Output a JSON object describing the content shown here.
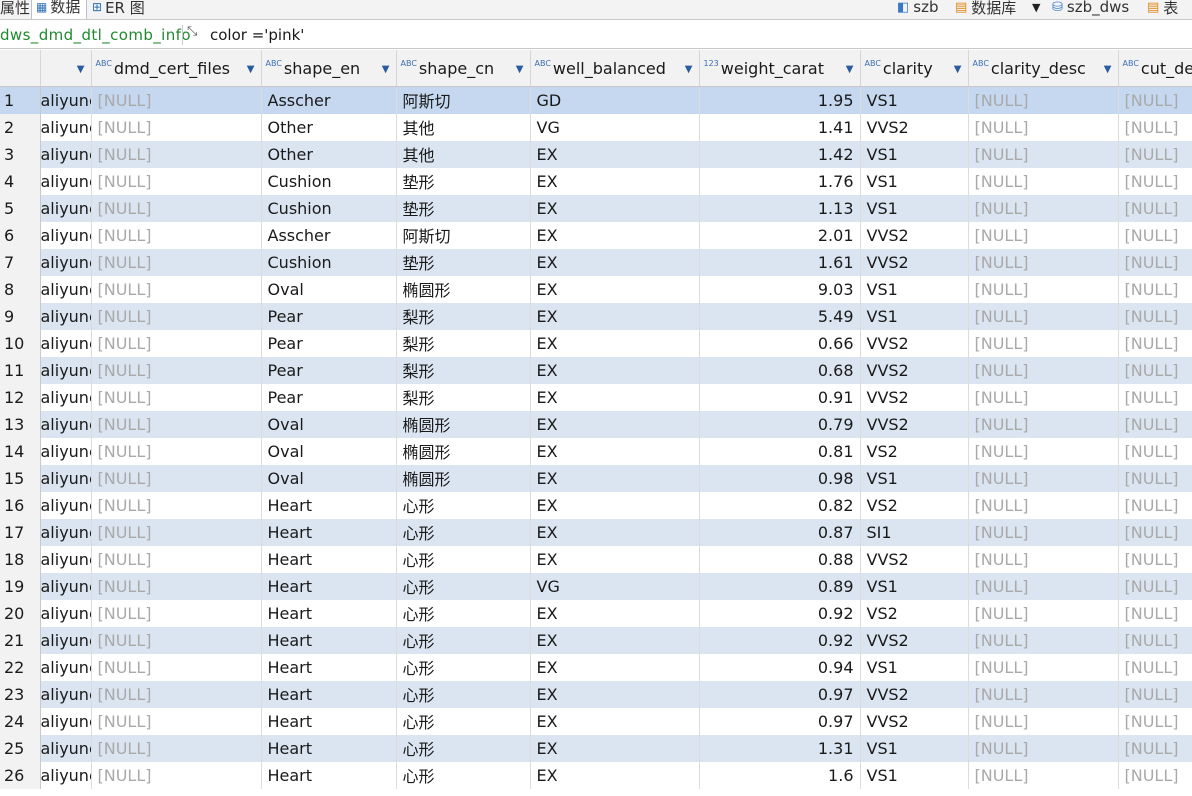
{
  "toolbar": {
    "tab_properties": "属性",
    "tab_data": "数据",
    "tab_er": "ER 图",
    "crumbs": {
      "connection": "szb",
      "database_label": "数据库",
      "schema": "szb_dws",
      "table_label": "表"
    }
  },
  "filter": {
    "table_name": "dws_dmd_dtl_comb_info",
    "expression": "color ='pink'"
  },
  "grid": {
    "columns": [
      {
        "label": "",
        "type": ""
      },
      {
        "label": "dmd_cert_files",
        "type": "ABC"
      },
      {
        "label": "shape_en",
        "type": "ABC"
      },
      {
        "label": "shape_cn",
        "type": "ABC"
      },
      {
        "label": "well_balanced",
        "type": "ABC"
      },
      {
        "label": "weight_carat",
        "type": "123"
      },
      {
        "label": "clarity",
        "type": "ABC"
      },
      {
        "label": "clarity_desc",
        "type": "ABC"
      },
      {
        "label": "cut_de",
        "type": "ABC"
      }
    ],
    "rows": [
      [
        "1",
        "aliyunc",
        "[NULL]",
        "Asscher",
        "阿斯切",
        "GD",
        "1.95",
        "VS1",
        "[NULL]",
        "[NULL]"
      ],
      [
        "2",
        "aliyunc",
        "[NULL]",
        "Other",
        "其他",
        "VG",
        "1.41",
        "VVS2",
        "[NULL]",
        "[NULL]"
      ],
      [
        "3",
        "aliyunc",
        "[NULL]",
        "Other",
        "其他",
        "EX",
        "1.42",
        "VS1",
        "[NULL]",
        "[NULL]"
      ],
      [
        "4",
        "aliyunc",
        "[NULL]",
        "Cushion",
        "垫形",
        "EX",
        "1.76",
        "VS1",
        "[NULL]",
        "[NULL]"
      ],
      [
        "5",
        "aliyunc",
        "[NULL]",
        "Cushion",
        "垫形",
        "EX",
        "1.13",
        "VS1",
        "[NULL]",
        "[NULL]"
      ],
      [
        "6",
        "aliyunc",
        "[NULL]",
        "Asscher",
        "阿斯切",
        "EX",
        "2.01",
        "VVS2",
        "[NULL]",
        "[NULL]"
      ],
      [
        "7",
        "aliyunc",
        "[NULL]",
        "Cushion",
        "垫形",
        "EX",
        "1.61",
        "VVS2",
        "[NULL]",
        "[NULL]"
      ],
      [
        "8",
        "aliyunc",
        "[NULL]",
        "Oval",
        "椭圆形",
        "EX",
        "9.03",
        "VS1",
        "[NULL]",
        "[NULL]"
      ],
      [
        "9",
        "aliyunc",
        "[NULL]",
        "Pear",
        "梨形",
        "EX",
        "5.49",
        "VS1",
        "[NULL]",
        "[NULL]"
      ],
      [
        "10",
        "aliyunc",
        "[NULL]",
        "Pear",
        "梨形",
        "EX",
        "0.66",
        "VVS2",
        "[NULL]",
        "[NULL]"
      ],
      [
        "11",
        "aliyunc",
        "[NULL]",
        "Pear",
        "梨形",
        "EX",
        "0.68",
        "VVS2",
        "[NULL]",
        "[NULL]"
      ],
      [
        "12",
        "aliyunc",
        "[NULL]",
        "Pear",
        "梨形",
        "EX",
        "0.91",
        "VVS2",
        "[NULL]",
        "[NULL]"
      ],
      [
        "13",
        "aliyunc",
        "[NULL]",
        "Oval",
        "椭圆形",
        "EX",
        "0.79",
        "VVS2",
        "[NULL]",
        "[NULL]"
      ],
      [
        "14",
        "aliyunc",
        "[NULL]",
        "Oval",
        "椭圆形",
        "EX",
        "0.81",
        "VS2",
        "[NULL]",
        "[NULL]"
      ],
      [
        "15",
        "aliyunc",
        "[NULL]",
        "Oval",
        "椭圆形",
        "EX",
        "0.98",
        "VS1",
        "[NULL]",
        "[NULL]"
      ],
      [
        "16",
        "aliyunc",
        "[NULL]",
        "Heart",
        "心形",
        "EX",
        "0.82",
        "VS2",
        "[NULL]",
        "[NULL]"
      ],
      [
        "17",
        "aliyunc",
        "[NULL]",
        "Heart",
        "心形",
        "EX",
        "0.87",
        "SI1",
        "[NULL]",
        "[NULL]"
      ],
      [
        "18",
        "aliyunc",
        "[NULL]",
        "Heart",
        "心形",
        "EX",
        "0.88",
        "VVS2",
        "[NULL]",
        "[NULL]"
      ],
      [
        "19",
        "aliyunc",
        "[NULL]",
        "Heart",
        "心形",
        "VG",
        "0.89",
        "VS1",
        "[NULL]",
        "[NULL]"
      ],
      [
        "20",
        "aliyunc",
        "[NULL]",
        "Heart",
        "心形",
        "EX",
        "0.92",
        "VS2",
        "[NULL]",
        "[NULL]"
      ],
      [
        "21",
        "aliyunc",
        "[NULL]",
        "Heart",
        "心形",
        "EX",
        "0.92",
        "VVS2",
        "[NULL]",
        "[NULL]"
      ],
      [
        "22",
        "aliyunc",
        "[NULL]",
        "Heart",
        "心形",
        "EX",
        "0.94",
        "VS1",
        "[NULL]",
        "[NULL]"
      ],
      [
        "23",
        "aliyunc",
        "[NULL]",
        "Heart",
        "心形",
        "EX",
        "0.97",
        "VVS2",
        "[NULL]",
        "[NULL]"
      ],
      [
        "24",
        "aliyunc",
        "[NULL]",
        "Heart",
        "心形",
        "EX",
        "0.97",
        "VVS2",
        "[NULL]",
        "[NULL]"
      ],
      [
        "25",
        "aliyunc",
        "[NULL]",
        "Heart",
        "心形",
        "EX",
        "1.31",
        "VS1",
        "[NULL]",
        "[NULL]"
      ],
      [
        "26",
        "aliyunc",
        "[NULL]",
        "Heart",
        "心形",
        "EX",
        "1.6",
        "VS1",
        "[NULL]",
        "[NULL]"
      ]
    ],
    "selected_row": "1"
  },
  "colors": {
    "odd_row": "#dbe5f1",
    "selected_row": "#c5d8ef",
    "null_text": "#a9a9a9",
    "table_name": "#1f8a2e",
    "header_bg": "#f2f2f2"
  }
}
